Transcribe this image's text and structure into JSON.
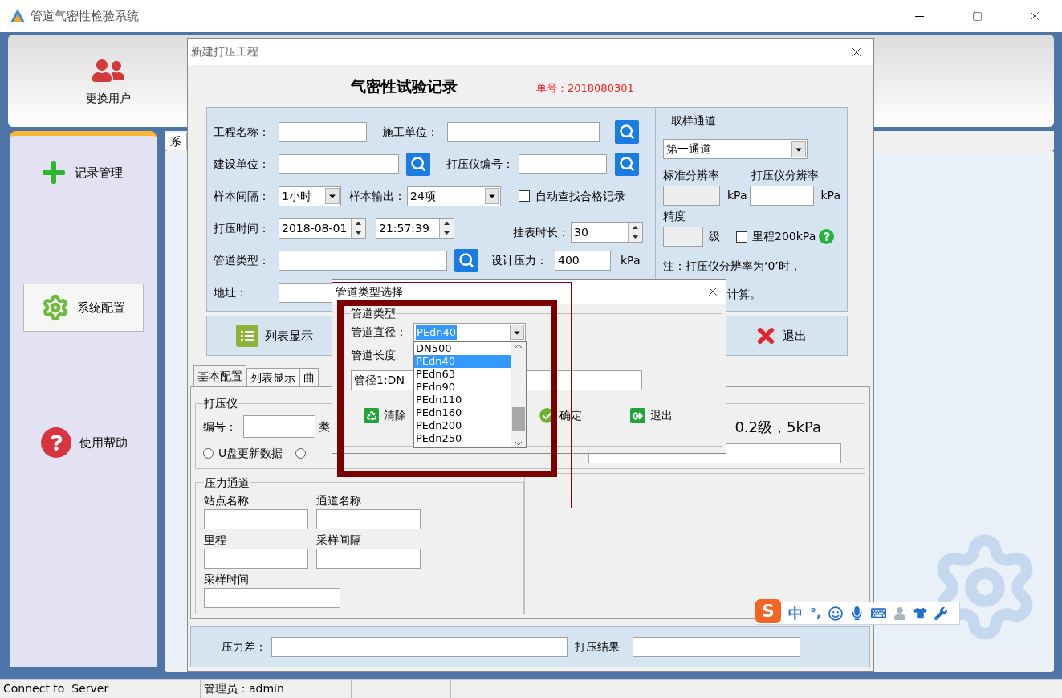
{
  "window": {
    "title": "管道气密性检验系统"
  },
  "banner": {
    "switch_user": "更换用户"
  },
  "sidebar": {
    "items": [
      {
        "label": "记录管理",
        "selected": false,
        "kind": "add"
      },
      {
        "label": "系统配置",
        "selected": true,
        "kind": "config"
      },
      {
        "label": "使用帮助",
        "selected": false,
        "kind": "help"
      }
    ]
  },
  "main_tabs": [
    {
      "label": "系",
      "selected": true
    }
  ],
  "project_dialog": {
    "title": "新建打压工程",
    "heading": "气密性试验记录",
    "order_no": "单号：2018080301",
    "project_name_label": "工程名称：",
    "constructor_label": "施工单位：",
    "builder_label": "建设单位：",
    "tester_no_label": "打压仪编号：",
    "interval_label": "样本间隔：",
    "interval_value": "1小时",
    "output_label": "样本输出：",
    "output_value": "24项",
    "auto_find": {
      "label": "自动查找合格记录",
      "checked": false
    },
    "time_label": "打压时间：",
    "date_value": "2018-08-01",
    "time_value": "21:57:39",
    "hang_label": "挂表时长：",
    "hang_value": "30",
    "pipe_type_label": "管道类型：",
    "design_pressure_label": "设计压力：",
    "design_pressure_value": "400",
    "design_pressure_unit": "kPa",
    "address_label": "地址：",
    "sampling": {
      "title": "取样通道",
      "channel": "第一通道",
      "std_res_label": "标准分辨率",
      "tester_res_label": "打压仪分辨率",
      "std_res_unit": "kPa",
      "tester_res_unit": "kPa",
      "std_res_disabled": true,
      "precision_label": "精度",
      "precision_disabled": true,
      "grade_unit": "级",
      "range200": {
        "label": "里程200kPa",
        "checked": false
      },
      "note_line1": "注：打压仪分辨率为‘0’时，",
      "note_line2": "计算。"
    },
    "list_button": "列表显示",
    "exit_button": "退出",
    "tabs": [
      {
        "label": "基本配置",
        "selected": true
      },
      {
        "label": "列表显示",
        "selected": false
      },
      {
        "label": "曲",
        "selected": false
      }
    ],
    "tester_group": {
      "title": "打压仪",
      "number_label": "编号：",
      "type_label": "类",
      "radios": [
        {
          "label": "U盘更新数据",
          "selected": false
        },
        {
          "selected": false
        }
      ],
      "spec": "0.2级，5kPa"
    },
    "channel_group": {
      "title": "压力通道",
      "fields": [
        {
          "label": "站点名称"
        },
        {
          "label": "通道名称"
        },
        {
          "label": "里程"
        },
        {
          "label": "采样间隔"
        },
        {
          "label": "采样时间"
        }
      ]
    },
    "pressure_diff_label": "压力差：",
    "result_label": "打压结果"
  },
  "pipe_dialog": {
    "title": "管道类型选择",
    "group": "管道类型",
    "diameter_label": "管道直径：",
    "diameter_value": "PEdn40",
    "length_label": "管道长度",
    "pipe_text": "管径1:DN_",
    "options": [
      {
        "label": "DN500",
        "selected": false
      },
      {
        "label": "PEdn40",
        "selected": true
      },
      {
        "label": "PEdn63",
        "selected": false
      },
      {
        "label": "PEdn90",
        "selected": false
      },
      {
        "label": "PEdn110",
        "selected": false
      },
      {
        "label": "PEdn160",
        "selected": false
      },
      {
        "label": "PEdn200",
        "selected": false
      },
      {
        "label": "PEdn250",
        "selected": false
      }
    ],
    "buttons": [
      {
        "label": "清除",
        "kind": "clear"
      },
      {
        "label": "确定",
        "kind": "ok"
      },
      {
        "label": "退出",
        "kind": "exit"
      }
    ]
  },
  "ime": {
    "logo": "S",
    "mode": "中",
    "punct": "°,"
  },
  "status_bar": {
    "connection": "Connect to  Server",
    "user": "管理员：admin"
  }
}
